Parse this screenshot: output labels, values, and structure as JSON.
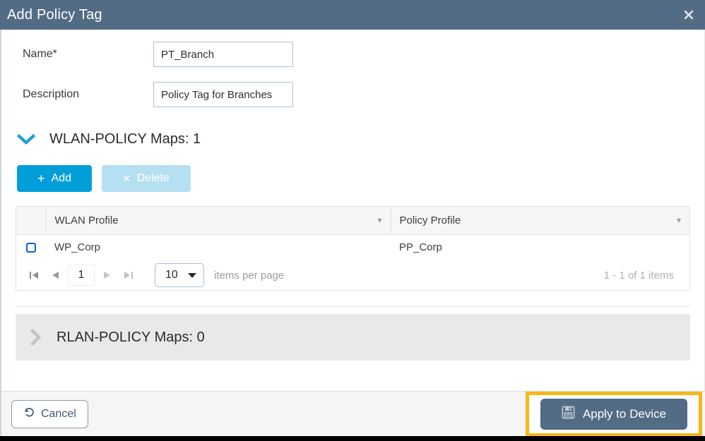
{
  "dialog": {
    "title": "Add Policy Tag",
    "close_icon": "close-icon"
  },
  "form": {
    "name": {
      "label": "Name*",
      "value": "PT_Branch",
      "placeholder": ""
    },
    "description": {
      "label": "Description",
      "value": "Policy Tag for Branches",
      "placeholder": ""
    }
  },
  "wlan_section": {
    "title": "WLAN-POLICY Maps: 1",
    "expanded": true,
    "caret_icon": "chevron-down-icon",
    "buttons": {
      "add": {
        "label": "Add",
        "glyph": "+",
        "icon": "plus-icon"
      },
      "delete": {
        "label": "Delete",
        "glyph": "×",
        "icon": "close-x-icon",
        "disabled": true
      }
    },
    "table": {
      "columns": [
        {
          "label": "WLAN Profile",
          "sort_icon": "chevron-down-icon"
        },
        {
          "label": "Policy Profile",
          "sort_icon": "chevron-down-icon"
        }
      ],
      "rows": [
        {
          "selected": false,
          "wlan_profile": "WP_Corp",
          "policy_profile": "PP_Corp"
        }
      ]
    },
    "pagination": {
      "first_icon": "first-page-icon",
      "prev_icon": "prev-page-icon",
      "page_value": "1",
      "next_icon": "next-page-icon",
      "last_icon": "last-page-icon",
      "page_size": "10",
      "page_size_label": "items per page",
      "items_count": "1 - 1 of 1 items"
    }
  },
  "rlan_section": {
    "title": "RLAN-POLICY Maps: 0",
    "expanded": false,
    "caret_icon": "chevron-right-icon"
  },
  "footer": {
    "cancel": {
      "label": "Cancel",
      "icon": "undo-icon"
    },
    "apply": {
      "label": "Apply to Device",
      "icon": "save-floppy-icon"
    }
  },
  "colors": {
    "header_bg": "#526c85",
    "accent_blue": "#019fd9",
    "disabled_blue": "#b5e0f2",
    "checkbox_blue": "#0b63ce",
    "highlight_orange": "#f5b81a",
    "apply_button": "#526c85",
    "section_gray": "#e9e9e9"
  }
}
